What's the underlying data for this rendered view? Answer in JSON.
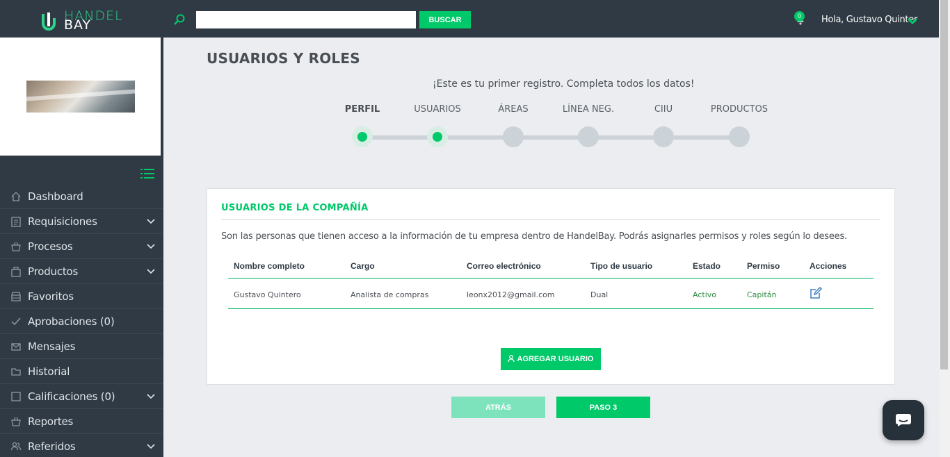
{
  "brand": {
    "line1": "HANDEL",
    "line2": "BAY",
    "accent": "#00c96a",
    "dark": "#2f3a44"
  },
  "header": {
    "search_placeholder": "",
    "search_value": "",
    "search_button": "BUSCAR",
    "notifications_count": "0",
    "greeting": "Hola, Gustavo Quinter"
  },
  "sidebar": {
    "items": [
      {
        "label": "Dashboard",
        "icon": "home-icon",
        "has_submenu": false
      },
      {
        "label": "Requisiciones",
        "icon": "clipboard-icon",
        "has_submenu": true
      },
      {
        "label": "Procesos",
        "icon": "basket-icon",
        "has_submenu": true
      },
      {
        "label": "Productos",
        "icon": "building-icon",
        "has_submenu": true
      },
      {
        "label": "Favoritos",
        "icon": "store-icon",
        "has_submenu": false
      },
      {
        "label": "Aprobaciones (0)",
        "icon": "check-icon",
        "has_submenu": false
      },
      {
        "label": "Mensajes",
        "icon": "envelope-icon",
        "has_submenu": false
      },
      {
        "label": "Historial",
        "icon": "folder-icon",
        "has_submenu": false
      },
      {
        "label": "Calificaciones (0)",
        "icon": "square-icon",
        "has_submenu": true
      },
      {
        "label": "Reportes",
        "icon": "basket-icon",
        "has_submenu": false
      },
      {
        "label": "Referidos",
        "icon": "users-icon",
        "has_submenu": true
      }
    ]
  },
  "main": {
    "title": "USUARIOS Y ROLES",
    "first_registration_msg": "¡Este es tu primer registro. Completa todos los datos!",
    "steps": [
      {
        "label": "PERFIL",
        "done": true,
        "active": true
      },
      {
        "label": "USUARIOS",
        "done": true,
        "active": false
      },
      {
        "label": "ÁREAS",
        "done": false,
        "active": false
      },
      {
        "label": "LÍNEA NEG.",
        "done": false,
        "active": false
      },
      {
        "label": "CIIU",
        "done": false,
        "active": false
      },
      {
        "label": "PRODUCTOS",
        "done": false,
        "active": false
      }
    ],
    "card": {
      "title": "USUARIOS DE LA COMPAÑÍA",
      "description": "Son las personas que tienen acceso a la información de tu empresa dentro de HandelBay. Podrás asignarles permisos y roles según lo desees.",
      "columns": [
        "Nombre completo",
        "Cargo",
        "Correo electrónico",
        "Tipo de usuario",
        "Estado",
        "Permiso",
        "Acciones"
      ],
      "rows": [
        {
          "nombre": "Gustavo Quintero",
          "cargo": "Analista de compras",
          "correo": "leonx2012@gmail.com",
          "tipo": "Dual",
          "estado": "Activo",
          "permiso": "Capitán"
        }
      ],
      "add_button": "AGREGAR USUARIO"
    },
    "back_button": "ATRÁS",
    "next_button": "PASO 3"
  }
}
